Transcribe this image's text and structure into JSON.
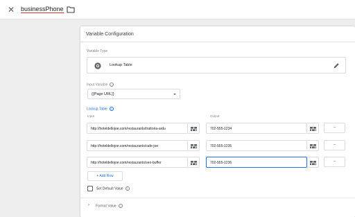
{
  "header": {
    "close_glyph": "✕",
    "variable_name": "businessPhone"
  },
  "panel": {
    "title": "Variable Configuration",
    "variable_type_label": "Variable Type",
    "variable_type": "Lookup Table",
    "input_variable_label": "Input Variable",
    "input_variable_value": "{{Page URL}}",
    "lookup_table_label": "Lookup Table",
    "col_input": "Input",
    "col_output": "Output",
    "help_glyph": "?",
    "rows": [
      {
        "input": "http://hoteldellojoe.com/restaurants/trattoria-ardu",
        "output": "702-555-1234",
        "remove": "–"
      },
      {
        "input": "http://hoteldellojoe.com/restaurants/cafe-joe",
        "output": "702-555-1235",
        "remove": "–"
      },
      {
        "input": "http://hoteldellojoe.com/restaurants/seo-buffer",
        "output": "702-555-1236",
        "remove": "–"
      }
    ],
    "add_row_label": "+ Add Row",
    "set_default_label": "Set Default Value",
    "format_chevron": "›",
    "format_value_label": "Format Value"
  },
  "colors": {
    "accent": "#1a73e8",
    "error_underline": "#d93025"
  }
}
